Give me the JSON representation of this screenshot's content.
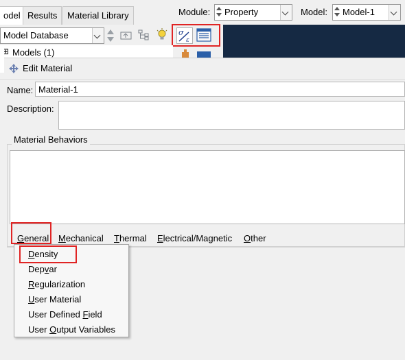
{
  "tabs": [
    {
      "label": "odel",
      "underline_char": ""
    },
    {
      "label": "Results"
    },
    {
      "label": "Material Library"
    }
  ],
  "module": {
    "label": "Module:",
    "value": "Property"
  },
  "model": {
    "label": "Model:",
    "value": "Model-1"
  },
  "model_db": {
    "value": "Model Database"
  },
  "tree": {
    "models": "Models (1)"
  },
  "dialog": {
    "title": "Edit Material",
    "name_label": "Name:",
    "name_value": "Material-1",
    "description_label": "Description:",
    "behaviors_label": "Material Behaviors"
  },
  "menubar": [
    {
      "pre": "",
      "ul": "G",
      "post": "eneral"
    },
    {
      "pre": "",
      "ul": "M",
      "post": "echanical"
    },
    {
      "pre": "",
      "ul": "T",
      "post": "hermal"
    },
    {
      "pre": "",
      "ul": "E",
      "post": "lectrical/Magnetic"
    },
    {
      "pre": "",
      "ul": "O",
      "post": "ther"
    }
  ],
  "general_menu": [
    {
      "pre": "",
      "ul": "D",
      "post": "ensity"
    },
    {
      "pre": "Dep",
      "ul": "v",
      "post": "ar"
    },
    {
      "pre": "",
      "ul": "R",
      "post": "egularization"
    },
    {
      "pre": "",
      "ul": "U",
      "post": "ser Material"
    },
    {
      "pre": "User Defined ",
      "ul": "F",
      "post": "ield"
    },
    {
      "pre": "User ",
      "ul": "O",
      "post": "utput Variables"
    }
  ],
  "colors": {
    "highlight": "#e02424",
    "viewport": "#152943"
  },
  "icons": [
    "arrow-up-icon",
    "arrow-down-icon",
    "folder-up-icon",
    "tree-icon",
    "lightbulb-icon",
    "material-create-icon",
    "material-manager-icon",
    "gear-icon"
  ]
}
